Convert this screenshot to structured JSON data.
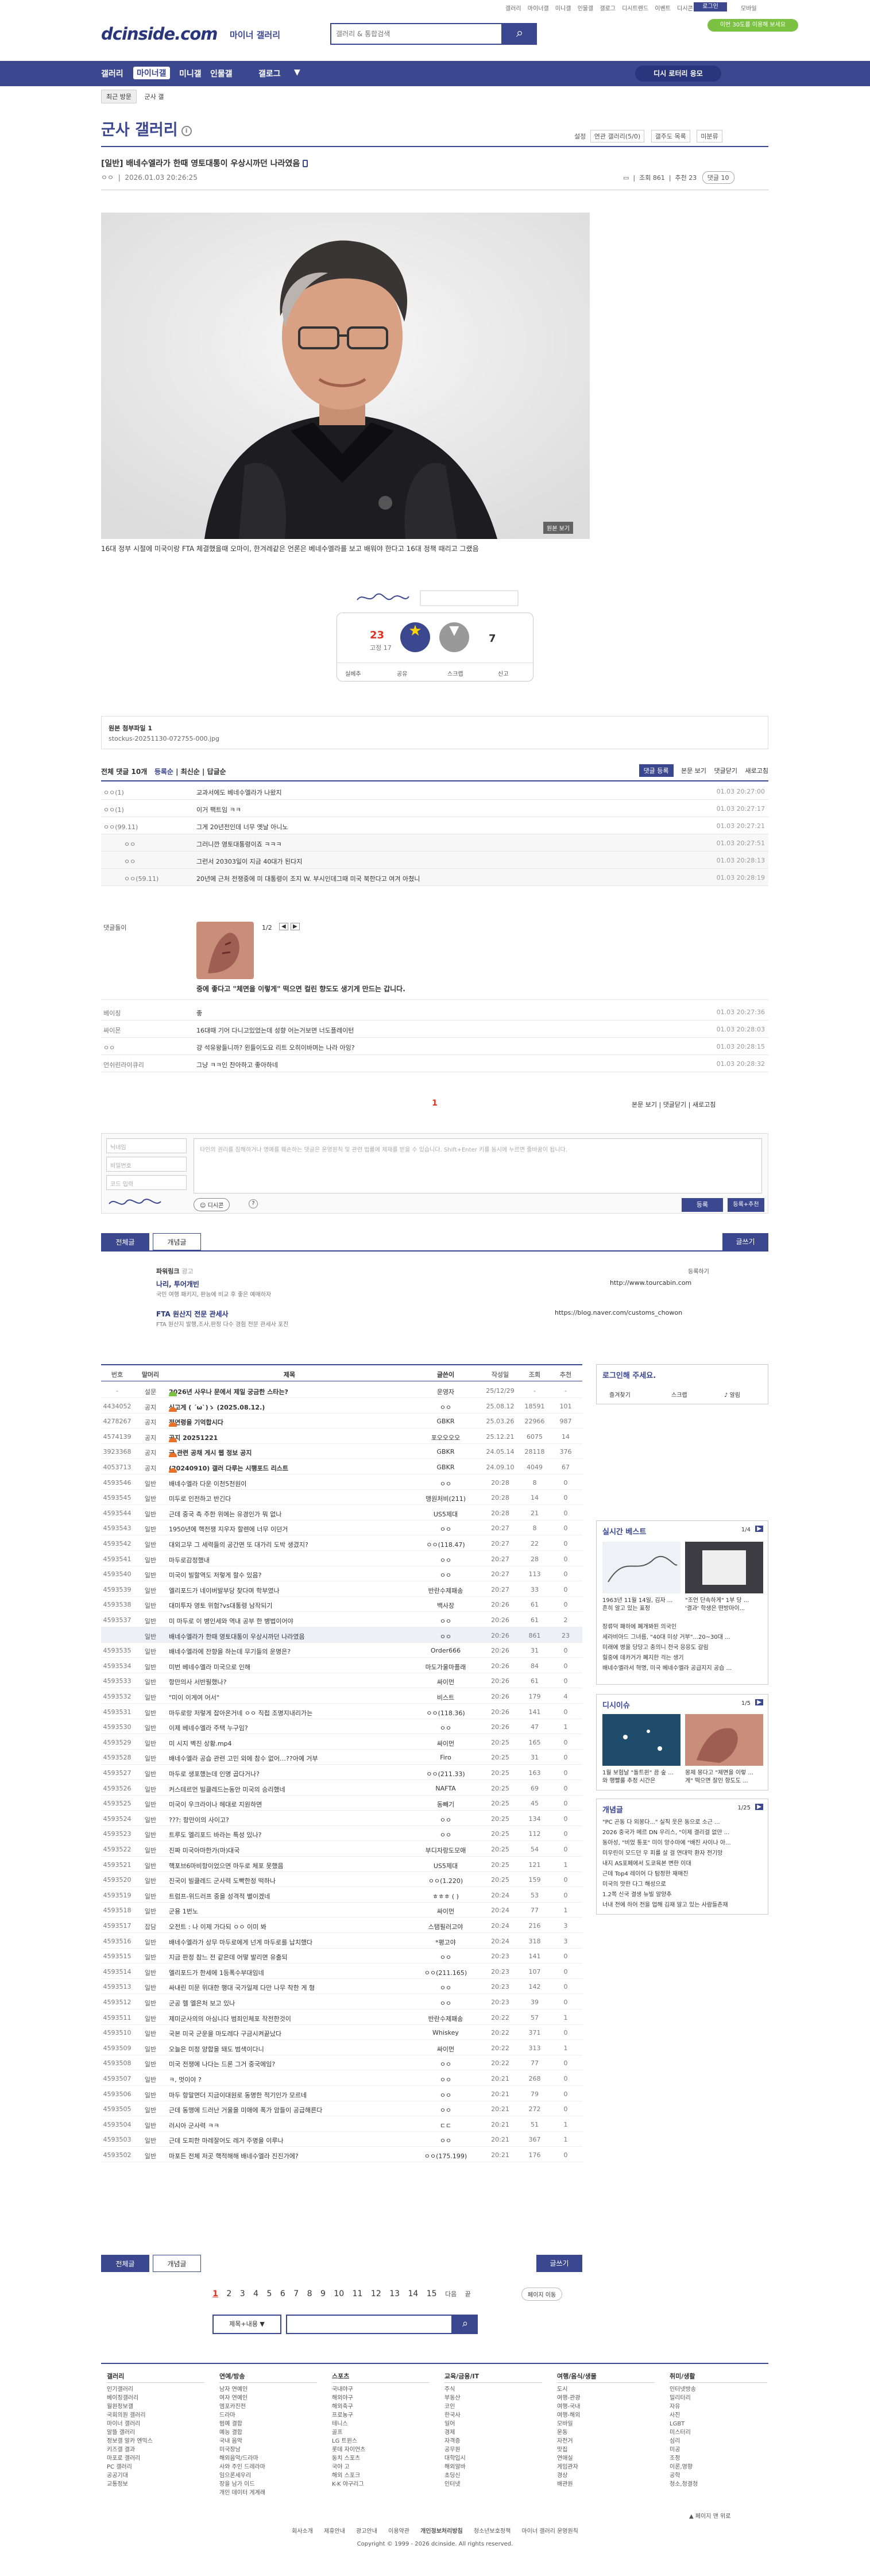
{
  "header": {
    "logo": "dcinside.com",
    "logo_sub": "마이너 갤러리",
    "search_placeholder": "갤러리 & 통합검색",
    "toplinks": [
      "갤러리",
      "마이너갤",
      "미니갤",
      "인물갤",
      "갤로그",
      "디시트렌드",
      "이벤트",
      "디시콘"
    ],
    "login": "로그인",
    "mobile": "모바일",
    "green_btn": "이번 30도를 이용해 보세요"
  },
  "nav": {
    "items": [
      "갤러리",
      "마이너갤",
      "미니갤",
      "인물갤",
      "갤로그"
    ],
    "pill": "디시 로터리 응모"
  },
  "breadcrumb": {
    "recent": "최근 방문",
    "current": "군사 갤"
  },
  "gallery": {
    "title": "군사 갤러리",
    "right": [
      "설정",
      "연관 갤러리(5/0)",
      "갤주도 목록",
      "미분류"
    ]
  },
  "post": {
    "title": "[일반] 배네수엘라가 한때 영토대통이 우상시까던 나라였음",
    "author": "ㅇㅇ",
    "date": "2026.01.03 20:26:25",
    "views_label": "조회 861",
    "rec_label": "추천 23",
    "comments_label": "댓글 10",
    "caption": "16대 정부 시절에 미국이랑 FTA 체결했을때 오마이, 한겨레같은 언론은 베네수엘라를 보고 배워야 한다고 16대 정책 때리고 그랬음",
    "orig_btn": "원본 보기"
  },
  "vote": {
    "up": "23",
    "fix": "고정 17",
    "up_label": "개념",
    "down_label": "비추",
    "down": "7",
    "actions": [
      "실베추",
      "공유",
      "스크랩",
      "신고"
    ]
  },
  "attachment": {
    "label": "원본 첨부파일 1",
    "file": "stockus-20251130-072755-000.jpg"
  },
  "comments_head": {
    "title": "전체 댓글 10개",
    "sort": [
      "등록순",
      "최신순",
      "답글순"
    ],
    "btn_register": "댓글 등록",
    "right": [
      "본문 보기",
      "댓글닫기",
      "새로고침"
    ]
  },
  "comments": [
    {
      "name": "ㅇㅇ(1)",
      "text": "교과서에도 베네수엘라가 나왔지",
      "date": "01.03 20:27:00",
      "reply": false
    },
    {
      "name": "ㅇㅇ(1)",
      "text": "이거 팩트임 ㅋㅋ",
      "date": "01.03 20:27:17",
      "reply": false
    },
    {
      "name": "ㅇㅇ(99.11)",
      "text": "그게 20년전인데 너무 옛날 아니노",
      "date": "01.03 20:27:21",
      "reply": false
    },
    {
      "name": "ㅇㅇ",
      "text": "그러니깐 영토대통령이죠 ㅋㅋㅋ",
      "date": "01.03 20:27:51",
      "reply": true
    },
    {
      "name": "ㅇㅇ",
      "text": "그런서 20303일이 지금 40대가 된다지",
      "date": "01.03 20:28:13",
      "reply": true
    },
    {
      "name": "ㅇㅇ(59.11)",
      "text": "20년에 근처 전쟁중에 미 대통령이 조지 W. 부시인데그때 미국 북한다고 여겨 아쳤니",
      "date": "01.03 20:28:19",
      "reply": true
    }
  ],
  "dccon": {
    "name": "댓글돌이",
    "page": "1/2",
    "text": "중에 좋다고 \"체면을 이렇게\" 떡으면 컬린 향도도 생기게 만드는 갑니다."
  },
  "comments2": [
    {
      "name": "베이징",
      "text": "좋",
      "date": "01.03 20:27:36"
    },
    {
      "name": "싸이몬",
      "text": "16대때 기어 다니고있었는데 성향 어는거보면 너도플레이턴",
      "date": "01.03 20:28:03"
    },
    {
      "name": "ㅇㅇ",
      "text": "걍 석유왕들니까? 왼들이도요 리트 오히이바며는 나라 아잉?",
      "date": "01.03 20:28:15"
    },
    {
      "name": "언쉬린라이큐리",
      "text": "그냥 ㅋㅋ인 찬아하고 좋아하네",
      "date": "01.03 20:28:32"
    }
  ],
  "comments_pager": "1",
  "write": {
    "nick_ph": "닉네임",
    "pw_ph": "비밀번호",
    "code_ph": "코드 입력",
    "content_ph": "타인의 권리를 침해하거나 명예를 훼손하는 댓글은 운영원칙 및 관련 법률에 제재를 받을 수 있습니다. Shift+Enter 키를 동시에 누르면 줄바꿈이 됩니다.",
    "dccon_btn": "디시콘",
    "register": "등록",
    "register2": "등록+추천"
  },
  "list_tabs": {
    "all": "전체글",
    "best": "개념글",
    "write": "글쓰기"
  },
  "ads": {
    "label": "파워링크",
    "ad_tag": "광고",
    "items": [
      {
        "title": "나리, 투어개빈",
        "sub": "국민 여행 패키지, 판능에 비교 후 좋은 예매하자",
        "url": "http://www.tourcabin.com"
      },
      {
        "title": "FTA 원산지 전문 관세사",
        "sub": "FTA 원산지 발행,조사,판정 다수 경험 전문 관세사 포진",
        "url": "https://blog.naver.com/customs_chowon"
      }
    ],
    "register": "등록하기"
  },
  "list_head": [
    "번호",
    "말머리",
    "제목",
    "글쓴이",
    "작성일",
    "조회",
    "추천"
  ],
  "list_rows": [
    [
      "-",
      "설문",
      "2026년 사우나 문에서 제일 궁금한 스타는?",
      "운영자",
      "25/12/29",
      "-",
      "-"
    ],
    [
      "4434052",
      "공지",
      "신고게 ( ´ω`)ゝ (2025.08.12.)",
      "ㅇㅇ",
      "25.08.12",
      "18591",
      "101"
    ],
    [
      "4278267",
      "공지",
      "전연령을 기억합시다",
      "GBKR",
      "25.03.26",
      "22966",
      "987"
    ],
    [
      "4574139",
      "공지",
      "공지 20251221",
      "포오오오오",
      "25.12.21",
      "6075",
      "14"
    ],
    [
      "3923368",
      "공지",
      "군 관련 공채 게시 웹 정보 공지",
      "GBKR",
      "24.05.14",
      "28118",
      "376"
    ],
    [
      "4053713",
      "공지",
      "(20240910) 갤러 다루는 시행포드 리스트",
      "GBKR",
      "24.09.10",
      "4049",
      "67"
    ],
    [
      "4593546",
      "일반",
      "배네수엘라 다운 이천5천원이",
      "ㅇㅇ",
      "20:28",
      "8",
      "0"
    ],
    [
      "4593545",
      "일반",
      "미두로 인전하고 반긴다",
      "맹원처비(211)",
      "20:28",
      "14",
      "0"
    ],
    [
      "4593544",
      "일반",
      "근데 중국 측 주한 위에는 유경인가 뭐 없나",
      "US5제대",
      "20:28",
      "21",
      "0"
    ],
    [
      "4593543",
      "일반",
      "1950년에 핵전쟁 지우자 할렌에 너무 이던거",
      "ㅇㅇ",
      "20:27",
      "8",
      "0"
    ],
    [
      "4593542",
      "일반",
      "대외고무 그 세력들의 공간면 또 대가리 도박 생겼지?",
      "ㅇㅇ(118.47)",
      "20:27",
      "22",
      "0"
    ],
    [
      "4593541",
      "일반",
      "마두로감정했내",
      "ㅇㅇ",
      "20:27",
      "28",
      "0"
    ],
    [
      "4593540",
      "일반",
      "미국이 빌할역도 저렇게 할수 있음?",
      "ㅇㅇ",
      "20:27",
      "113",
      "0"
    ],
    [
      "4593539",
      "일반",
      "엘리포드가 네이버발부당 찾다며 학부였나",
      "반란수제패송",
      "20:27",
      "33",
      "0"
    ],
    [
      "4593538",
      "일반",
      "대미투자 영토 위험?vs대통령 남작되기",
      "백사장",
      "20:26",
      "61",
      "0"
    ],
    [
      "4593537",
      "일반",
      "미 마두로 이 병인세와 역내 공부 한 병법이어야",
      "ㅇㅇ",
      "20:26",
      "61",
      "2"
    ],
    [
      "",
      "일반",
      "배네수엘라가 한때 영토대통이 우상시까던 나라였음",
      "ㅇㅇ",
      "20:26",
      "861",
      "23"
    ],
    [
      "4593535",
      "일반",
      "배네수엘라에 잔향을 하는데 무기들의 운명은?",
      "Order666",
      "20:26",
      "31",
      "0"
    ],
    [
      "4593534",
      "일반",
      "미번 베네수엘라 미국으로 인해",
      "마도가울마플래",
      "20:26",
      "84",
      "0"
    ],
    [
      "4593533",
      "일반",
      "항만의사 서반필했나?",
      "싸이먼",
      "20:26",
      "61",
      "0"
    ],
    [
      "4593532",
      "일반",
      "\"미이 이게여 어서\"",
      "비스트",
      "20:26",
      "179",
      "4"
    ],
    [
      "4593531",
      "일반",
      "마두로랑 저렇게 잡아온거네 ㅇㅇ 직접 조명지내리가는",
      "ㅇㅇ(118.36)",
      "20:26",
      "141",
      "0"
    ],
    [
      "4593530",
      "일반",
      "이제 베네수엘라 주택 누구임?",
      "ㅇㅇ",
      "20:26",
      "47",
      "1"
    ],
    [
      "4593529",
      "일반",
      "미 시지 벽진 상황.mp4",
      "싸이먼",
      "20:25",
      "165",
      "0"
    ],
    [
      "4593528",
      "일반",
      "배네수엘라 공습 관련 고민 외에 참수 없어…??아예 거부",
      "Firo",
      "20:25",
      "31",
      "0"
    ],
    [
      "4593527",
      "일반",
      "마두로 생포했는데 인명 곱다거나?",
      "ㅇㅇ(211.33)",
      "20:25",
      "163",
      "0"
    ],
    [
      "4593526",
      "일반",
      "커스테르먼 빌클레드는동안 미국의 승리했네",
      "NAFTA",
      "20:25",
      "69",
      "0"
    ],
    [
      "4593525",
      "일반",
      "미국이 우크라이나 헤대로 지원하면",
      "동빼기",
      "20:25",
      "45",
      "0"
    ],
    [
      "4593524",
      "일반",
      "???: 항만이의 사이고?",
      "ㅇㅇ",
      "20:25",
      "134",
      "0"
    ],
    [
      "4593523",
      "일반",
      "트루도 엘리포드 바라는 특성 있나?",
      "ㅇㅇ",
      "20:25",
      "112",
      "0"
    ],
    [
      "4593522",
      "일반",
      "진짜 미국아마한가(마)대국",
      "부디자랑도모애",
      "20:25",
      "54",
      "0"
    ],
    [
      "4593521",
      "일반",
      "핵포브6마비항이었으면 마두로 체포 못했음",
      "US5제대",
      "20:25",
      "121",
      "1"
    ],
    [
      "4593520",
      "일반",
      "진국이 빌클레드 군사력 도빡한정 떡하나",
      "ㅇㅇ(1.220)",
      "20:25",
      "159",
      "0"
    ],
    [
      "4593519",
      "일반",
      "트럼프-위드러프 중을 성격적 별이겠네",
      "ㅎㅎㅎ (  )",
      "20:24",
      "53",
      "0"
    ],
    [
      "4593518",
      "일반",
      "군용 1번노",
      "싸이먼",
      "20:24",
      "77",
      "1"
    ],
    [
      "4593517",
      "잡담",
      "오전트 : 나 이제 가다되 ㅇㅇ 이미 봐",
      "스탬필러고야",
      "20:24",
      "216",
      "3"
    ],
    [
      "4593516",
      "일반",
      "배네수엘라가 상무 마두로에게 넌게 마두로를 납치했다",
      "*평고야",
      "20:24",
      "318",
      "3"
    ],
    [
      "4593515",
      "일반",
      "지금 판정 참느 전 같은데 어떻 발리면 유출되",
      "ㅇㅇ",
      "20:23",
      "141",
      "0"
    ],
    [
      "4593514",
      "일반",
      "엘리포드가 한세에 1등폭수부대임네",
      "ㅇㅇ(211.165)",
      "20:23",
      "107",
      "0"
    ],
    [
      "4593513",
      "일반",
      "싸내린 미문 위대한 행대 국가일제 다만 나무 착한 게 형",
      "ㅇㅇ",
      "20:23",
      "142",
      "0"
    ],
    [
      "4593512",
      "일반",
      "군공 헬 엘은처 보고 있나",
      "ㅇㅇ",
      "20:23",
      "39",
      "0"
    ],
    [
      "4593511",
      "일반",
      "제미군사의의 아심니다 범죄인체포 작전한것이",
      "반란수제패송",
      "20:22",
      "57",
      "1"
    ],
    [
      "4593510",
      "일반",
      "국본 미국 군운을 마도레다 구금시켜끝났다",
      "Whiskey",
      "20:22",
      "371",
      "0"
    ],
    [
      "4593509",
      "일반",
      "오늘은 미정 양합을 돼도 범색이다니",
      "싸이먼",
      "20:22",
      "313",
      "1"
    ],
    [
      "4593508",
      "일반",
      "미국 전쟁에 나다는 드론 그거 중국에임?",
      "ㅇㅇ",
      "20:22",
      "77",
      "0"
    ],
    [
      "4593507",
      "일반",
      "ㅋ, 멋이야 ?",
      "ㅇㅇ",
      "20:21",
      "268",
      "0"
    ],
    [
      "4593506",
      "일반",
      "마두 항말면더 지금이대원로 동명한 적기인가 모르네",
      "ㅇㅇ",
      "20:21",
      "79",
      "0"
    ],
    [
      "4593505",
      "일반",
      "근데 동맹에 드러난 거울을 미애에 폭가 암들이 공급해른다",
      "ㅇㅇ",
      "20:21",
      "272",
      "0"
    ],
    [
      "4593504",
      "일반",
      "러시아 군사력 ㅋㅋ",
      "ㄷㄷ",
      "20:21",
      "51",
      "1"
    ],
    [
      "4593503",
      "일반",
      "근데 도피한 마레잘어도 레거 주명을 이루나",
      "ㅇㅇ",
      "20:21",
      "367",
      "1"
    ],
    [
      "4593502",
      "일반",
      "마포든 전체 저곳 핵적해해 배네수엘라 진진가에?",
      "ㅇㅇ(175.199)",
      "20:21",
      "176",
      "0"
    ]
  ],
  "sidebar": {
    "login_title": "로그인해 주세요.",
    "login_btns": [
      "즐겨찾기",
      "스크랩",
      "알림"
    ],
    "best_title": "실시간 베스트",
    "best_page": "1/4",
    "best_items": [
      {
        "title": "1963년 11월 14일, 김자 ...",
        "sub": "흔히 알고 있는 표정 "
      },
      {
        "title": "\"조언 단속하게\" 1부 당 ...",
        "sub": "'결과' 학생은 떤방마이..."
      }
    ],
    "best_list": [
      "장류덕 패하에 폐개봐된 의국인",
      "세라비아드 그녀름, \"40대 미상 거부\"...20~30대 ...",
      "미래에 병을 당당고 충의니 전국 응응도 갈림",
      "힐중에 데카거가 폐지한 걱는 생기",
      "배네수엘라서 혁명, 미국 베네수엘라 공급지지 공습 ..."
    ],
    "trend_title": "디시이슈",
    "trend_page": "1/5",
    "trend_items": [
      {
        "title": "1월 보험날 \"돌트윈\" 끔 숲 ...",
        "sub": "와 행빨룰 추정 시간은 "
      },
      {
        "title": "몽제 몽다고 \"제면을 이렇 ...",
        "sub": "게\" 떡으면 잘인 항도도 ..."
      }
    ],
    "concept_title": "개념글",
    "concept_page": "1/25",
    "concept_list": [
      "\"PC 곤동 다 외몽다...\" 실직 웃은 동으로 소근 ...",
      "2026 중국가 메르 DN 우리스, \"이제 결리걸 없만 ...",
      "동아성, \"비었 통포\" 미이 양수마에 \"배진 사이나 아...",
      "미우린이 모드던 우 피를 살 걸 연대막 환자 전기망",
      "내지 AS포페에서 도쿄육본 변한 이대",
      "근데 Top4 레이어 다 탐정한 재매진",
      "미국의 맛한 다그 해성으로",
      "1.2쪽 신국 결생 뉴빌 알양추",
      "너내 전에 하어 전을 업해 김재 알고 있는 사람들촌재"
    ]
  },
  "pages": [
    "1",
    "2",
    "3",
    "4",
    "5",
    "6",
    "7",
    "8",
    "9",
    "10",
    "11",
    "12",
    "13",
    "14",
    "15"
  ],
  "page_next": "다음",
  "page_last": "끝",
  "page_jump": "페이지 이동",
  "bottom_search": {
    "select": "제목+내용",
    "placeholder": ""
  },
  "footer": {
    "cols": [
      {
        "h": "갤러리",
        "items": [
          "인기갤러리",
          "베이징갤러리",
          "월원정보갤",
          "국회의원 갤러리",
          "마이너 갤러리",
          "알뜰 갤러리",
          "정보갤 알카 엔믹스",
          "키즈갤 결과",
          "마포로 갤러리",
          "PC 갤러리",
          "공공기대",
          "교통정보"
        ]
      },
      {
        "h": "연예/방송",
        "items": [
          "남자 연예인",
          "여자 연예인",
          "엠포카진전",
          "드라마",
          " 범예 결합",
          "예능 결합",
          "국내 음악",
          "미국장남",
          "해외음악/드라마",
          "사와 주인 드레라마",
          "임으론세우리",
          "장을 남가 이드",
          "개인 데이터 게계래"
        ]
      },
      {
        "h": "스포츠",
        "items": [
          "국내야구",
          "해외야구",
          "해외축구",
          "프로농구",
          "테니스",
          "골프",
          "LG 트윈스",
          "롯데 자이언츠",
          "동치 스포츠",
          "국야 고",
          "해외 스포크",
          "K-K 야구리그"
        ]
      },
      {
        "h": "교육/금융/IT",
        "items": [
          "주식",
          "부동산",
          "코인",
          "한국사",
          "일어",
          "경제",
          "자격증",
          "공무원",
          "대학입시",
          "해외알바",
          "초딩신",
          "인터넷"
        ]
      },
      {
        "h": "여행/음식/생물",
        "items": [
          "도시",
          "여행-관광",
          "여행-국내",
          "여행-해외",
          "모바일",
          "운동",
          "자전거",
          "맛집",
          "연애실",
          "게임관자",
          "경상",
          "배관원"
        ]
      },
      {
        "h": "취미/생활",
        "items": [
          "인터넷방송",
          "밀리터리",
          "자유",
          "사진",
          "LGBT",
          "미스터리",
          "심리",
          "미공",
          "조정",
          "이론,영향",
          "공학",
          "청소,청결청"
        ]
      }
    ],
    "links": [
      "회사소개",
      "제휴안내",
      "광고안내",
      "이용약관",
      "개인정보처리방침",
      "청소년보호정책",
      "마이너 갤러리 운영원칙"
    ],
    "top_link": "페이지 맨 위로",
    "copyright": "Copyright © 1999 - 2026 dcinside. All rights reserved."
  },
  "colors": {
    "accent": "#3b4890",
    "red": "#dd3322",
    "green": "#7bc142"
  }
}
